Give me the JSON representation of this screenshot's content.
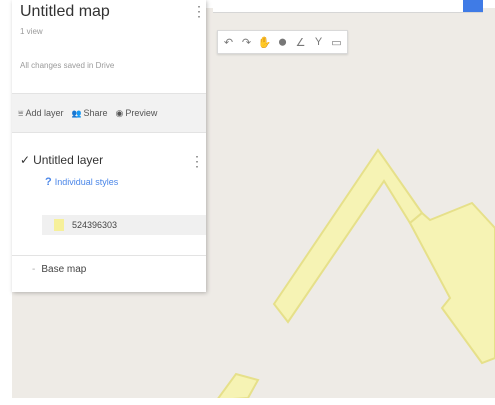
{
  "colors": {
    "map_background": "#eeebe6",
    "shape_fill": "#f6f3b4",
    "shape_stroke": "#e6e08a",
    "accent": "#3f7be6",
    "link": "#4a86e8"
  },
  "panel": {
    "title": "Untitled map",
    "views": "1 view",
    "saved_status": "All changes saved in Drive",
    "menu_icon": "⋮",
    "actions": [
      {
        "icon": "add-layer-icon",
        "glyph": "⩸",
        "label": "Add layer"
      },
      {
        "icon": "share-icon",
        "glyph": "👥",
        "label": "Share"
      },
      {
        "icon": "preview-icon",
        "glyph": "◉",
        "label": "Preview"
      }
    ],
    "layer": {
      "checkbox": "✓",
      "name": "Untitled layer",
      "menu_icon": "⋮",
      "style_icon": "?",
      "style_link": "Individual styles",
      "item_label": "524396303"
    },
    "basemap": {
      "toggle": "-",
      "label": "Base map"
    }
  },
  "toolbar": {
    "tools": [
      {
        "name": "undo-icon",
        "glyph": "↶"
      },
      {
        "name": "redo-icon",
        "glyph": "↷"
      },
      {
        "name": "hand-icon",
        "glyph": "✋"
      },
      {
        "name": "marker-icon",
        "glyph": "⬤"
      },
      {
        "name": "draw-line-icon",
        "glyph": "∠"
      },
      {
        "name": "directions-icon",
        "glyph": "Y"
      },
      {
        "name": "ruler-icon",
        "glyph": "▭"
      }
    ]
  }
}
